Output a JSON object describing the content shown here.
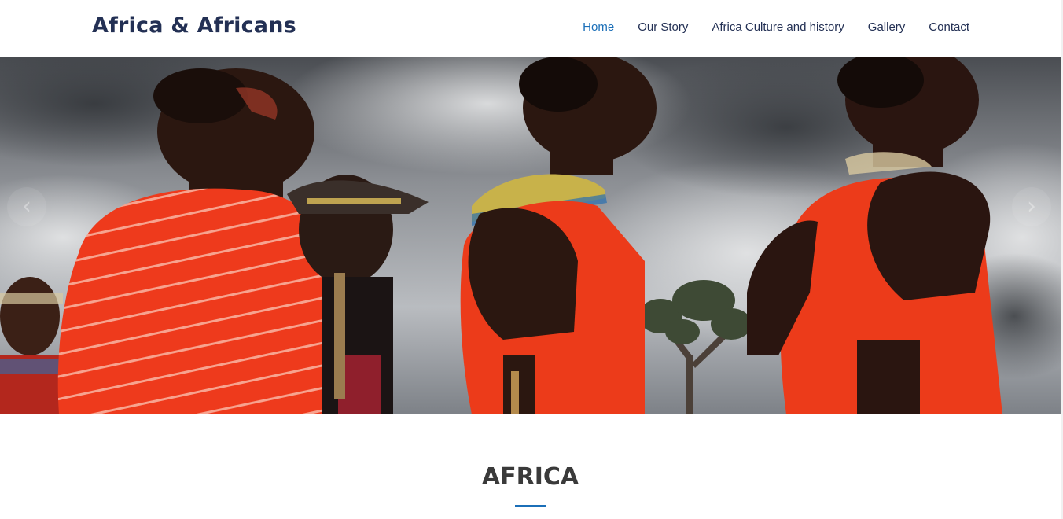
{
  "header": {
    "brand": "Africa & Africans",
    "nav": [
      {
        "label": "Home",
        "active": true
      },
      {
        "label": "Our Story",
        "active": false
      },
      {
        "label": "Africa Culture and history",
        "active": false
      },
      {
        "label": "Gallery",
        "active": false
      },
      {
        "label": "Contact",
        "active": false
      }
    ],
    "active_color": "#1b6fb8",
    "text_color": "#233054"
  },
  "hero": {
    "prev_icon": "chevron-left-icon",
    "next_icon": "chevron-right-icon",
    "prev_glyph": "‹",
    "next_glyph": "›"
  },
  "section": {
    "title": "AFRICA",
    "accent_color": "#1b6fb8"
  }
}
